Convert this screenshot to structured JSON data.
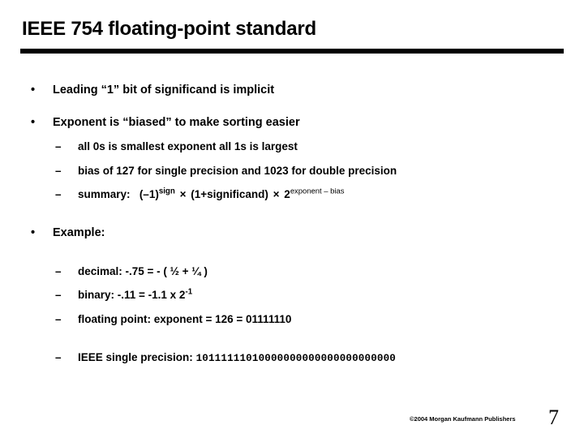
{
  "slide": {
    "title": "IEEE 754 floating-point standard",
    "bullets": [
      {
        "marker": "•",
        "text": "Leading “1” bit of significand is implicit"
      },
      {
        "marker": "•",
        "text": "Exponent is “biased” to make sorting easier"
      }
    ],
    "exponent_subbullets": [
      {
        "marker": "–",
        "text": "all 0s is smallest exponent all 1s is largest"
      },
      {
        "marker": "–",
        "text": "bias of 127 for single precision and 1023 for double precision"
      }
    ],
    "summary": {
      "marker": "–",
      "label": "summary:",
      "sign_base": "(–1)",
      "sign_exp": "sign",
      "times1": "×",
      "significand": "(1+significand)",
      "times2": "×",
      "two": "2",
      "two_exp": "exponent – bias"
    },
    "example": {
      "marker": "•",
      "label": "Example:",
      "lines": [
        {
          "marker": "–",
          "text": "decimal:  -.75 = - ( ½ + ¼ )"
        },
        {
          "marker": "–",
          "text_prefix": "binary:  -.11 = -1.1 x 2",
          "exponent": "-1"
        },
        {
          "marker": "–",
          "text": "floating point:  exponent = 126 = 01111110"
        }
      ],
      "ieee_line": {
        "marker": "–",
        "label": "IEEE single precision:",
        "bits": "10111111010000000000000000000000"
      }
    }
  },
  "footer": {
    "credit": "©2004 Morgan Kaufmann Publishers",
    "page_number": "7"
  }
}
